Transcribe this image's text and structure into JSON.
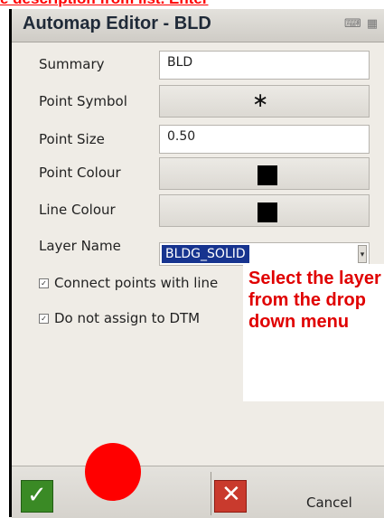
{
  "banner": {
    "text": "e description from list. Enter"
  },
  "window": {
    "title": "Automap Editor - BLD"
  },
  "form": {
    "summary_label": "Summary",
    "summary_value": "BLD",
    "point_symbol_label": "Point Symbol",
    "point_symbol_glyph": "∗",
    "point_size_label": "Point Size",
    "point_size_value": "0.50",
    "point_colour_label": "Point Colour",
    "point_colour": "#000000",
    "line_colour_label": "Line Colour",
    "line_colour": "#000000",
    "layer_name_label": "Layer Name",
    "layer_name_value": "BLDG_SOLID"
  },
  "options": {
    "connect_points": {
      "label": "Connect points with line",
      "checked": true
    },
    "no_dtm": {
      "label": "Do not assign to DTM",
      "checked": true
    }
  },
  "callout": {
    "text": "Select the layer from the drop down menu"
  },
  "actions": {
    "cancel_label": "Cancel"
  },
  "colors": {
    "callout_text": "#e00000",
    "accent_ok": "#3a8a25",
    "accent_cancel": "#c93a2d"
  }
}
